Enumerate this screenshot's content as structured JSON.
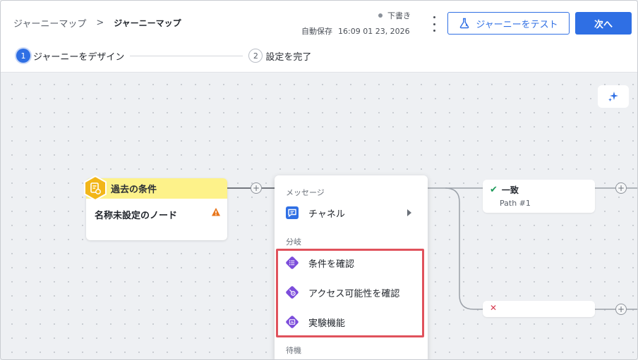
{
  "breadcrumb": {
    "root": "ジャーニーマップ",
    "separator": ">",
    "current": "ジャーニーマップ"
  },
  "status": {
    "label": "下書き",
    "autosave_label": "自動保存",
    "autosave_time": "16:09 01 23, 2026"
  },
  "buttons": {
    "test_journey": "ジャーニーをテスト",
    "next": "次へ"
  },
  "steps": [
    {
      "num": "1",
      "label": "ジャーニーをデザイン",
      "state": "active"
    },
    {
      "num": "2",
      "label": "設定を完了",
      "state": "inactive"
    }
  ],
  "node": {
    "type_label": "過去の条件",
    "title": "名称未設定のノード"
  },
  "paths": {
    "match": {
      "label": "一致",
      "sub": "Path #1"
    }
  },
  "menu": {
    "section_message": "メッセージ",
    "channel": "チャネル",
    "section_branch": "分岐",
    "check_condition": "条件を確認",
    "check_reachability": "アクセス可能性を確認",
    "experiment": "実験機能",
    "section_wait": "待機"
  },
  "colors": {
    "primary": "#2f6fe4",
    "node_header": "#fdf28a",
    "node_icon": "#f2b619",
    "branch_icon": "#7c4ddb",
    "channel_icon": "#2f6fe4",
    "highlight": "#e0525c",
    "match_check": "#1e9a5a",
    "nomatch_cross": "#d63a4f",
    "warning": "#e8751a"
  }
}
